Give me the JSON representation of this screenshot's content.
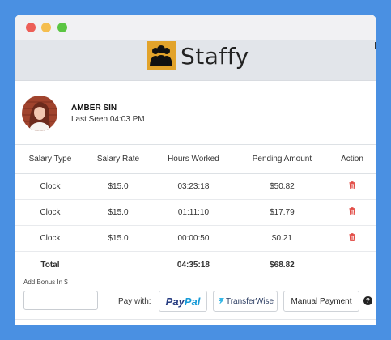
{
  "app": {
    "name": "Staffy",
    "brand_color": "#e2a32b",
    "background_color": "#4a90e2"
  },
  "user": {
    "name": "AMBER SIN",
    "last_seen": "Last Seen 04:03 PM"
  },
  "table": {
    "headers": [
      "Salary Type",
      "Salary Rate",
      "Hours Worked",
      "Pending Amount",
      "Action"
    ],
    "rows": [
      {
        "type": "Clock",
        "rate": "$15.0",
        "hours": "03:23:18",
        "amount": "$50.82",
        "action_icon": "trash-icon"
      },
      {
        "type": "Clock",
        "rate": "$15.0",
        "hours": "01:11:10",
        "amount": "$17.79",
        "action_icon": "trash-icon"
      },
      {
        "type": "Clock",
        "rate": "$15.0",
        "hours": "00:00:50",
        "amount": "$0.21",
        "action_icon": "trash-icon"
      }
    ],
    "total": {
      "label": "Total",
      "hours": "04:35:18",
      "amount": "$68.82"
    }
  },
  "payment": {
    "bonus_label": "Add Bonus In $",
    "bonus_value": "",
    "pay_with_label": "Pay with:",
    "paypal_label_1": "Pay",
    "paypal_label_2": "Pal",
    "transferwise_label": "TransferWise",
    "manual_label": "Manual Payment",
    "help_icon": "?"
  }
}
